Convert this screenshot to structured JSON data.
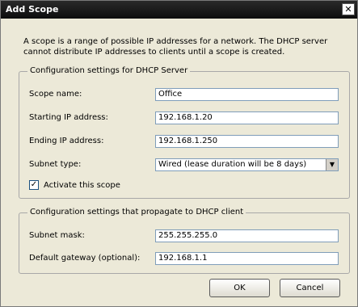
{
  "window": {
    "title": "Add Scope",
    "close_glyph": "✕"
  },
  "description": "A scope is a range of possible IP addresses for a network. The DHCP server cannot distribute IP addresses to clients until a scope is created.",
  "server_group": {
    "legend": "Configuration settings for DHCP Server",
    "scope_name_label": "Scope name:",
    "scope_name_value": "Office",
    "start_ip_label": "Starting IP address:",
    "start_ip_value": "192.168.1.20",
    "end_ip_label": "Ending IP address:",
    "end_ip_value": "192.168.1.250",
    "subnet_type_label": "Subnet type:",
    "subnet_type_value": "Wired (lease duration will be 8 days)",
    "activate_label": "Activate this scope",
    "activate_checked": true,
    "check_glyph": "✓",
    "arrow_glyph": "▼"
  },
  "client_group": {
    "legend": "Configuration settings that propagate to DHCP client",
    "subnet_mask_label": "Subnet mask:",
    "subnet_mask_value": "255.255.255.0",
    "gateway_label": "Default gateway (optional):",
    "gateway_value": "192.168.1.1"
  },
  "buttons": {
    "ok": "OK",
    "cancel": "Cancel"
  }
}
